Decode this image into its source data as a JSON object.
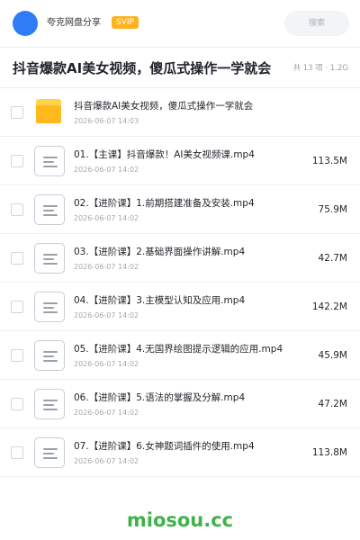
{
  "header": {
    "app_name": "夸克网盘分享",
    "badge": "SVIP",
    "search_placeholder": "搜索"
  },
  "title_bar": {
    "title": "抖音爆款AI美女视频，傻瓜式操作一学就会",
    "count_info": "共 13 项 · 1.2G"
  },
  "files": [
    {
      "name": "抖音爆款AI美女视频，傻瓜式操作一学就会",
      "date": "2026-06-07 14:03",
      "size": "",
      "icon": "folder-icon"
    },
    {
      "name": "01.【主课】抖音爆款！AI美女视频课.mp4",
      "date": "2026-06-07 14:02",
      "size": "113.5M",
      "icon": "file-icon"
    },
    {
      "name": "02.【进阶课】1.前期搭建准备及安装.mp4",
      "date": "2026-06-07 14:02",
      "size": "75.9M",
      "icon": "file-icon"
    },
    {
      "name": "03.【进阶课】2.基础界面操作讲解.mp4",
      "date": "2026-06-07 14:02",
      "size": "42.7M",
      "icon": "file-icon"
    },
    {
      "name": "04.【进阶课】3.主模型认知及应用.mp4",
      "date": "2026-06-07 14:02",
      "size": "142.2M",
      "icon": "file-icon"
    },
    {
      "name": "05.【进阶课】4.无国界绘图提示逻辑的应用.mp4",
      "date": "2026-06-07 14:02",
      "size": "45.9M",
      "icon": "file-icon"
    },
    {
      "name": "06.【进阶课】5.语法的掌握及分解.mp4",
      "date": "2026-06-07 14:02",
      "size": "47.2M",
      "icon": "file-icon"
    },
    {
      "name": "07.【进阶课】6.女神题词插件的使用.mp4",
      "date": "2026-06-07 14:02",
      "size": "113.8M",
      "icon": "file-icon"
    }
  ],
  "watermark": "miosou.cc",
  "colors": {
    "avatar": "#2f7cf6",
    "badge": "#ffb21f",
    "folder": "#ffb91d",
    "watermark": "#3fb24a"
  }
}
